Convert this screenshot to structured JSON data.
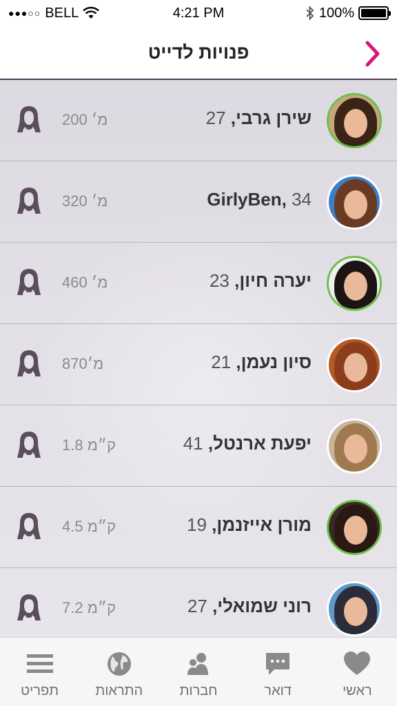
{
  "status_bar": {
    "signal": "●●●○○",
    "carrier": "BELL",
    "time": "4:21 PM",
    "battery_text": "100%",
    "battery_level": 1.0
  },
  "header": {
    "title": "פנויות לדייט",
    "back_icon": "chevron-right-icon",
    "accent_color": "#d6187a"
  },
  "list": {
    "items": [
      {
        "name": "שירן גרבי,",
        "age": "27",
        "distance": "200 מ׳",
        "online": true,
        "hair": "#3a2418",
        "bg": "#c9a77a"
      },
      {
        "name": "GirlyBen,",
        "age": "34",
        "distance": "320 מ׳",
        "online": false,
        "hair": "#6a3b22",
        "bg": "#3a7fc7"
      },
      {
        "name": "יערה חיון,",
        "age": "23",
        "distance": "460 מ׳",
        "online": true,
        "hair": "#1c1412",
        "bg": "#efefef"
      },
      {
        "name": "סיון נעמן,",
        "age": "21",
        "distance": "870מ׳",
        "online": false,
        "hair": "#8c3e1c",
        "bg": "#b35a25"
      },
      {
        "name": "יפעת ארנטל,",
        "age": "41",
        "distance": "1.8 ק״מ",
        "online": false,
        "hair": "#a07a4e",
        "bg": "#c9b59b"
      },
      {
        "name": "מורן אייזנמן,",
        "age": "19",
        "distance": "4.5 ק״מ",
        "online": true,
        "hair": "#2a1812",
        "bg": "#3a2a24"
      },
      {
        "name": "רוני שמואלי,",
        "age": "27",
        "distance": "7.2 ק״מ",
        "online": false,
        "hair": "#2b2b3a",
        "bg": "#5d9ac9"
      }
    ],
    "gender_icon": "woman-silhouette-icon"
  },
  "tab_bar": {
    "tabs": [
      {
        "label": "ראשי",
        "icon": "heart-icon"
      },
      {
        "label": "דואר",
        "icon": "chat-bubble-icon"
      },
      {
        "label": "חברות",
        "icon": "friends-icon"
      },
      {
        "label": "התראות",
        "icon": "globe-icon"
      },
      {
        "label": "תפריט",
        "icon": "menu-icon"
      }
    ]
  }
}
